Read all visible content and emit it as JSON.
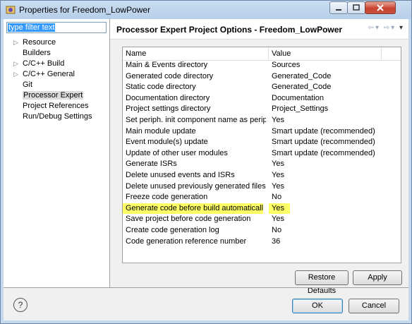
{
  "window": {
    "title": "Properties for Freedom_LowPower"
  },
  "filter": {
    "placeholder": "type filter text"
  },
  "tree": [
    {
      "label": "Resource",
      "expandable": true
    },
    {
      "label": "Builders",
      "expandable": false
    },
    {
      "label": "C/C++ Build",
      "expandable": true
    },
    {
      "label": "C/C++ General",
      "expandable": true
    },
    {
      "label": "Git",
      "expandable": false
    },
    {
      "label": "Processor Expert",
      "expandable": false,
      "selected": true
    },
    {
      "label": "Project References",
      "expandable": false
    },
    {
      "label": "Run/Debug Settings",
      "expandable": false
    }
  ],
  "page": {
    "title": "Processor Expert Project Options - Freedom_LowPower"
  },
  "table": {
    "headers": {
      "name": "Name",
      "value": "Value"
    },
    "rows": [
      {
        "name": "Main & Events directory",
        "value": "Sources"
      },
      {
        "name": "Generated code directory",
        "value": "Generated_Code"
      },
      {
        "name": "Static code directory",
        "value": "Generated_Code"
      },
      {
        "name": "Documentation directory",
        "value": "Documentation"
      },
      {
        "name": "Project settings directory",
        "value": "Project_Settings"
      },
      {
        "name": "Set periph. init component name as periphe...",
        "value": "Yes"
      },
      {
        "name": "Main module update",
        "value": "Smart update (recommended)"
      },
      {
        "name": "Event module(s) update",
        "value": "Smart update (recommended)"
      },
      {
        "name": "Update of other user modules",
        "value": "Smart update (recommended)"
      },
      {
        "name": "Generate ISRs",
        "value": "Yes"
      },
      {
        "name": "Delete unused events and ISRs",
        "value": "Yes"
      },
      {
        "name": "Delete unused previously generated files",
        "value": "Yes"
      },
      {
        "name": "Freeze code generation",
        "value": "No"
      },
      {
        "name": "Generate code before build automatically",
        "value": "Yes",
        "highlight": true
      },
      {
        "name": "Save project before code generation",
        "value": "Yes"
      },
      {
        "name": "Create code generation log",
        "value": "No"
      },
      {
        "name": "Code generation reference number",
        "value": "36"
      }
    ]
  },
  "buttons": {
    "restore": "Restore Defaults",
    "apply": "Apply",
    "ok": "OK",
    "cancel": "Cancel"
  },
  "colors": {
    "highlight": "#ffff66",
    "selection": "#3399ff"
  }
}
